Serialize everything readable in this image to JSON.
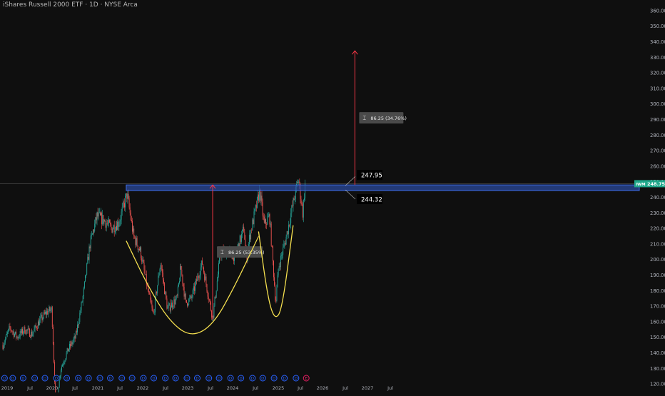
{
  "header": {
    "title": "iShares Russell 2000 ETF · 1D · NYSE Arca"
  },
  "chart_data": {
    "type": "candlestick",
    "title": "iShares Russell 2000 ETF · 1D · NYSE Arca",
    "symbol": "IWM",
    "last_price": 248.75,
    "last_price_label": "248.75",
    "ylim": [
      115,
      365
    ],
    "y_ticks": [
      "120.00",
      "130.00",
      "140.00",
      "150.00",
      "160.00",
      "170.00",
      "180.00",
      "190.00",
      "200.00",
      "210.00",
      "220.00",
      "230.00",
      "240.00",
      "250.00",
      "260.00",
      "270.00",
      "280.00",
      "290.00",
      "300.00",
      "310.00",
      "320.00",
      "330.00",
      "340.00",
      "350.00",
      "360.00"
    ],
    "x_ticks": [
      "2019",
      "Jul",
      "2020",
      "Jul",
      "2021",
      "Jul",
      "2022",
      "Jul",
      "2023",
      "Jul",
      "2024",
      "Jul",
      "2025",
      "Jul",
      "2026",
      "Jul",
      "2027",
      "Jul"
    ],
    "x_range": [
      "2019-01-01",
      "2027-12-01"
    ],
    "price_path": [
      [
        "2019-01-01",
        145
      ],
      [
        "2019-03-01",
        156
      ],
      [
        "2019-05-01",
        150
      ],
      [
        "2019-07-01",
        155
      ],
      [
        "2019-09-01",
        152
      ],
      [
        "2019-11-01",
        160
      ],
      [
        "2020-01-01",
        166
      ],
      [
        "2020-02-15",
        168
      ],
      [
        "2020-03-20",
        106
      ],
      [
        "2020-05-01",
        130
      ],
      [
        "2020-07-01",
        142
      ],
      [
        "2020-09-01",
        150
      ],
      [
        "2020-11-01",
        175
      ],
      [
        "2021-01-01",
        210
      ],
      [
        "2021-03-01",
        228
      ],
      [
        "2021-05-01",
        225
      ],
      [
        "2021-07-01",
        220
      ],
      [
        "2021-09-01",
        224
      ],
      [
        "2021-11-08",
        242
      ],
      [
        "2022-01-01",
        215
      ],
      [
        "2022-03-01",
        205
      ],
      [
        "2022-05-01",
        180
      ],
      [
        "2022-06-16",
        164
      ],
      [
        "2022-08-15",
        198
      ],
      [
        "2022-10-13",
        168
      ],
      [
        "2023-01-01",
        175
      ],
      [
        "2023-02-01",
        195
      ],
      [
        "2023-03-15",
        172
      ],
      [
        "2023-05-01",
        175
      ],
      [
        "2023-07-31",
        198
      ],
      [
        "2023-10-27",
        162
      ],
      [
        "2023-12-31",
        204
      ],
      [
        "2024-03-01",
        205
      ],
      [
        "2024-05-01",
        202
      ],
      [
        "2024-07-15",
        220
      ],
      [
        "2024-08-05",
        200
      ],
      [
        "2024-09-01",
        215
      ],
      [
        "2024-11-25",
        244
      ],
      [
        "2025-01-01",
        222
      ],
      [
        "2025-02-15",
        228
      ],
      [
        "2025-04-08",
        172
      ],
      [
        "2025-05-01",
        195
      ],
      [
        "2025-07-01",
        213
      ],
      [
        "2025-08-15",
        230
      ],
      [
        "2025-10-15",
        252
      ],
      [
        "2025-11-20",
        230
      ],
      [
        "2025-12-10",
        248.75
      ]
    ],
    "resistance_zone": {
      "top": 247.95,
      "bottom": 244.32,
      "top_label": "247.95",
      "bottom_label": "244.32",
      "from": "2021-11-01"
    },
    "measure_1": {
      "label": "86.25 (53.35%)",
      "date": "2023-10-27",
      "from_value": 161.7,
      "to_value": 247.95
    },
    "measure_2": {
      "label": "86.25 (34.76%)",
      "date": "2027-02-01",
      "from_value": 247.95,
      "to_value": 334.2
    },
    "cup_curve_points": [
      [
        "2021-11-01",
        212
      ],
      [
        "2022-05-01",
        183
      ],
      [
        "2022-11-01",
        160
      ],
      [
        "2023-05-01",
        150
      ],
      [
        "2023-11-01",
        158
      ],
      [
        "2024-05-01",
        183
      ],
      [
        "2024-11-15",
        215
      ]
    ],
    "handle_curve_points": [
      [
        "2024-11-15",
        218
      ],
      [
        "2025-02-01",
        175
      ],
      [
        "2025-04-01",
        161
      ],
      [
        "2025-06-01",
        168
      ],
      [
        "2025-09-01",
        222
      ]
    ],
    "event_markers": [
      {
        "date": "2019-01-15",
        "label": "D"
      },
      {
        "date": "2019-03-25",
        "label": "D"
      },
      {
        "date": "2019-06-20",
        "label": "D"
      },
      {
        "date": "2019-09-25",
        "label": "D"
      },
      {
        "date": "2019-12-20",
        "label": "D"
      },
      {
        "date": "2020-03-25",
        "label": "D"
      },
      {
        "date": "2020-06-20",
        "label": "D"
      },
      {
        "date": "2020-09-25",
        "label": "D"
      },
      {
        "date": "2020-12-20",
        "label": "D"
      },
      {
        "date": "2021-03-25",
        "label": "D"
      },
      {
        "date": "2021-06-20",
        "label": "D"
      },
      {
        "date": "2021-09-25",
        "label": "D"
      },
      {
        "date": "2021-12-20",
        "label": "D"
      },
      {
        "date": "2022-03-25",
        "label": "D"
      },
      {
        "date": "2022-06-20",
        "label": "D"
      },
      {
        "date": "2022-09-25",
        "label": "D"
      },
      {
        "date": "2022-12-20",
        "label": "D"
      },
      {
        "date": "2023-03-25",
        "label": "D"
      },
      {
        "date": "2023-06-20",
        "label": "D"
      },
      {
        "date": "2023-09-25",
        "label": "D"
      },
      {
        "date": "2023-12-20",
        "label": "D"
      },
      {
        "date": "2024-03-25",
        "label": "D"
      },
      {
        "date": "2024-06-20",
        "label": "D"
      },
      {
        "date": "2024-09-25",
        "label": "D"
      },
      {
        "date": "2024-12-20",
        "label": "D"
      },
      {
        "date": "2025-03-25",
        "label": "D"
      },
      {
        "date": "2025-06-20",
        "label": "D"
      },
      {
        "date": "2025-09-25",
        "label": "D"
      },
      {
        "date": "2025-12-20",
        "label": "E"
      }
    ],
    "colors": {
      "background": "#0f0f0f",
      "up": "#26a69a",
      "down": "#ef5350",
      "zone_fill": "#2b4a9b",
      "zone_border": "#3f6ee8",
      "measure": "#f23645",
      "curve": "#f5e04f",
      "price_tag": "#1fa78a",
      "axis_text": "#b2b5be",
      "crosshair": "#555555",
      "marker_dividend": "#2962ff",
      "marker_earnings": "#e91e63"
    }
  }
}
